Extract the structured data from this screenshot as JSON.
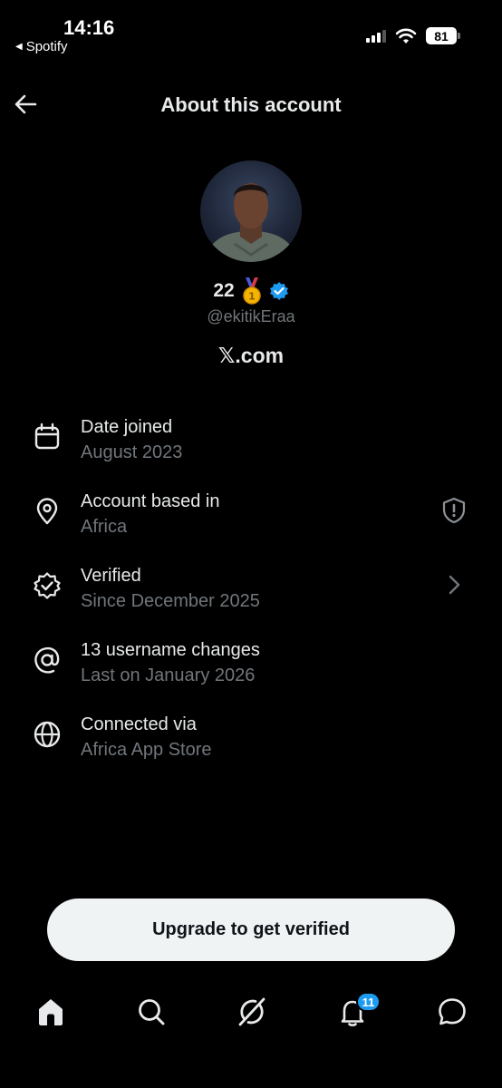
{
  "status_bar": {
    "time": "14:16",
    "back_app": "Spotify",
    "battery": "81"
  },
  "header": {
    "title": "About this account"
  },
  "profile": {
    "display_name": "22",
    "handle": "@ekitikEraa",
    "site": "𝕏.com",
    "verified": true
  },
  "info_rows": [
    {
      "icon": "calendar-icon",
      "title": "Date joined",
      "subtitle": "August 2023"
    },
    {
      "icon": "location-pin-icon",
      "title": "Account based in",
      "subtitle": "Africa",
      "trailing": "shield-info-icon"
    },
    {
      "icon": "verified-badge-icon",
      "title": "Verified",
      "subtitle": "Since December 2025",
      "trailing": "chevron-right-icon"
    },
    {
      "icon": "at-sign-icon",
      "title": "13 username changes",
      "subtitle": "Last on January 2026"
    },
    {
      "icon": "globe-icon",
      "title": "Connected via",
      "subtitle": "Africa App Store"
    }
  ],
  "upgrade_button": {
    "label": "Upgrade to get verified"
  },
  "bottom_nav": {
    "items": [
      "home-icon",
      "search-icon",
      "grok-icon",
      "notifications-icon",
      "messages-icon"
    ],
    "notifications_badge": "11"
  },
  "colors": {
    "background": "#000000",
    "primary_text": "#e7e9ea",
    "secondary_text": "#71767b",
    "accent": "#1d9bf0"
  }
}
